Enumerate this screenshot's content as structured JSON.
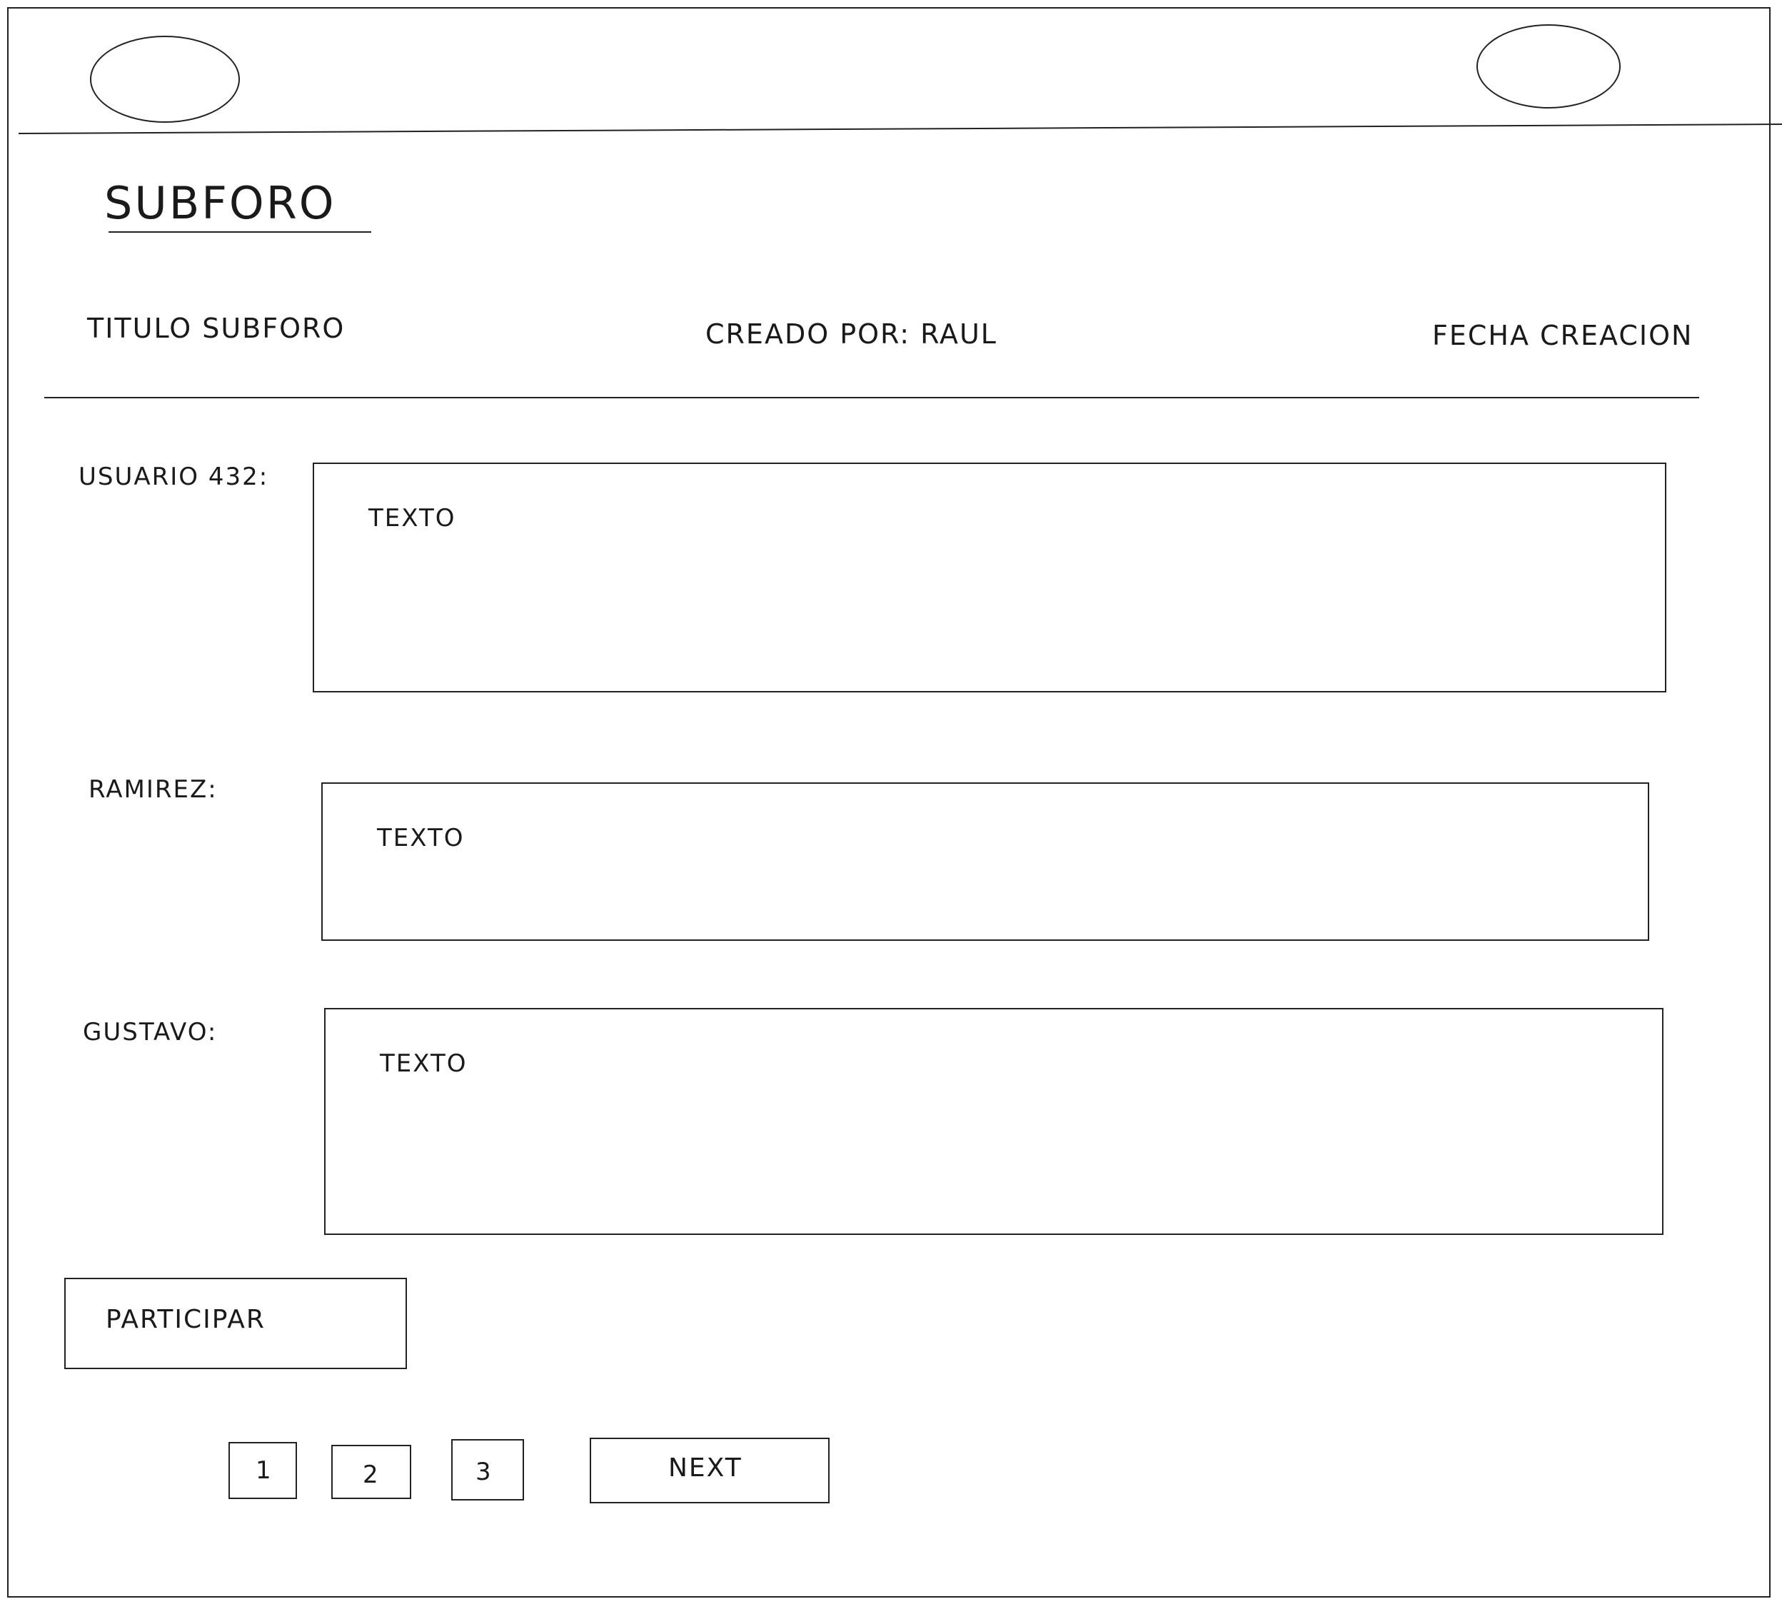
{
  "header": {
    "left_icon": "placeholder-circle",
    "right_icon": "placeholder-circle"
  },
  "page": {
    "title": "SUBFORO"
  },
  "subforum": {
    "title": "TITULO SUBFORO",
    "created_by": "CREADO POR: RAUL",
    "created_date": "FECHA CREACION"
  },
  "posts": [
    {
      "author": "USUARIO 432:",
      "text": "TEXTO"
    },
    {
      "author": "RAMIREZ:",
      "text": "TEXTO"
    },
    {
      "author": "GUSTAVO:",
      "text": "TEXTO"
    }
  ],
  "actions": {
    "participate_label": "PARTICIPAR"
  },
  "pagination": {
    "pages": [
      "1",
      "2",
      "3"
    ],
    "next_label": "NEXT"
  }
}
